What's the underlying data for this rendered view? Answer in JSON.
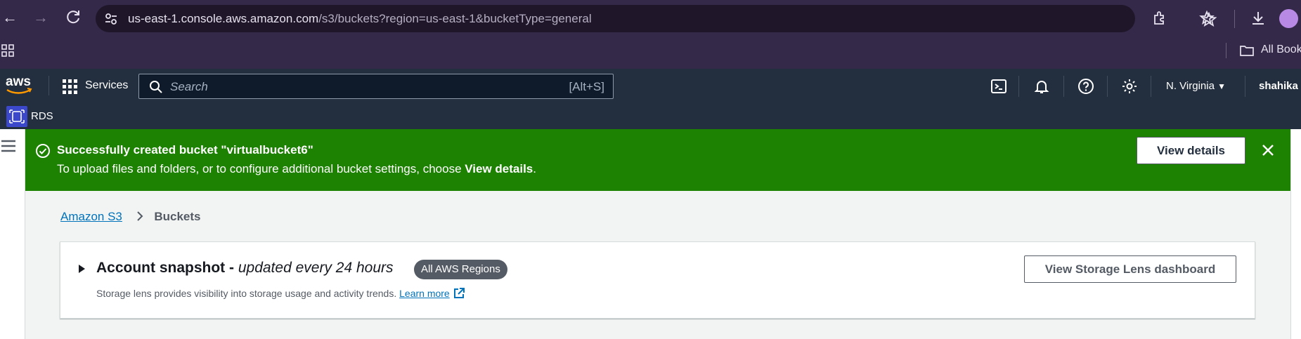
{
  "browser": {
    "url_host": "us-east-1.console.aws.amazon.com",
    "url_path": "/s3/buckets?region=us-east-1&bucketType=general",
    "bookmarks_label": "All Bookm"
  },
  "aws_header": {
    "services_label": "Services",
    "search_placeholder": "Search",
    "search_shortcut": "[Alt+S]",
    "region": "N. Virginia",
    "user": "shahika"
  },
  "favorites": {
    "items": [
      {
        "label": "RDS"
      }
    ]
  },
  "flash": {
    "title": "Successfully created bucket \"virtualbucket6\"",
    "body_prefix": "To upload files and folders, or to configure additional bucket settings, choose ",
    "body_bold": "View details",
    "body_suffix": ".",
    "button_label": "View details"
  },
  "breadcrumb": {
    "root": "Amazon S3",
    "current": "Buckets"
  },
  "snapshot": {
    "title": "Account snapshot - ",
    "subtitle": "updated every 24 hours",
    "badge": "All AWS Regions",
    "description": "Storage lens provides visibility into storage usage and activity trends. ",
    "learn_more": "Learn more",
    "button_label": "View Storage Lens dashboard"
  },
  "colors": {
    "flash_success": "#1d8102",
    "aws_nav": "#232f3e",
    "link": "#0073bb"
  }
}
